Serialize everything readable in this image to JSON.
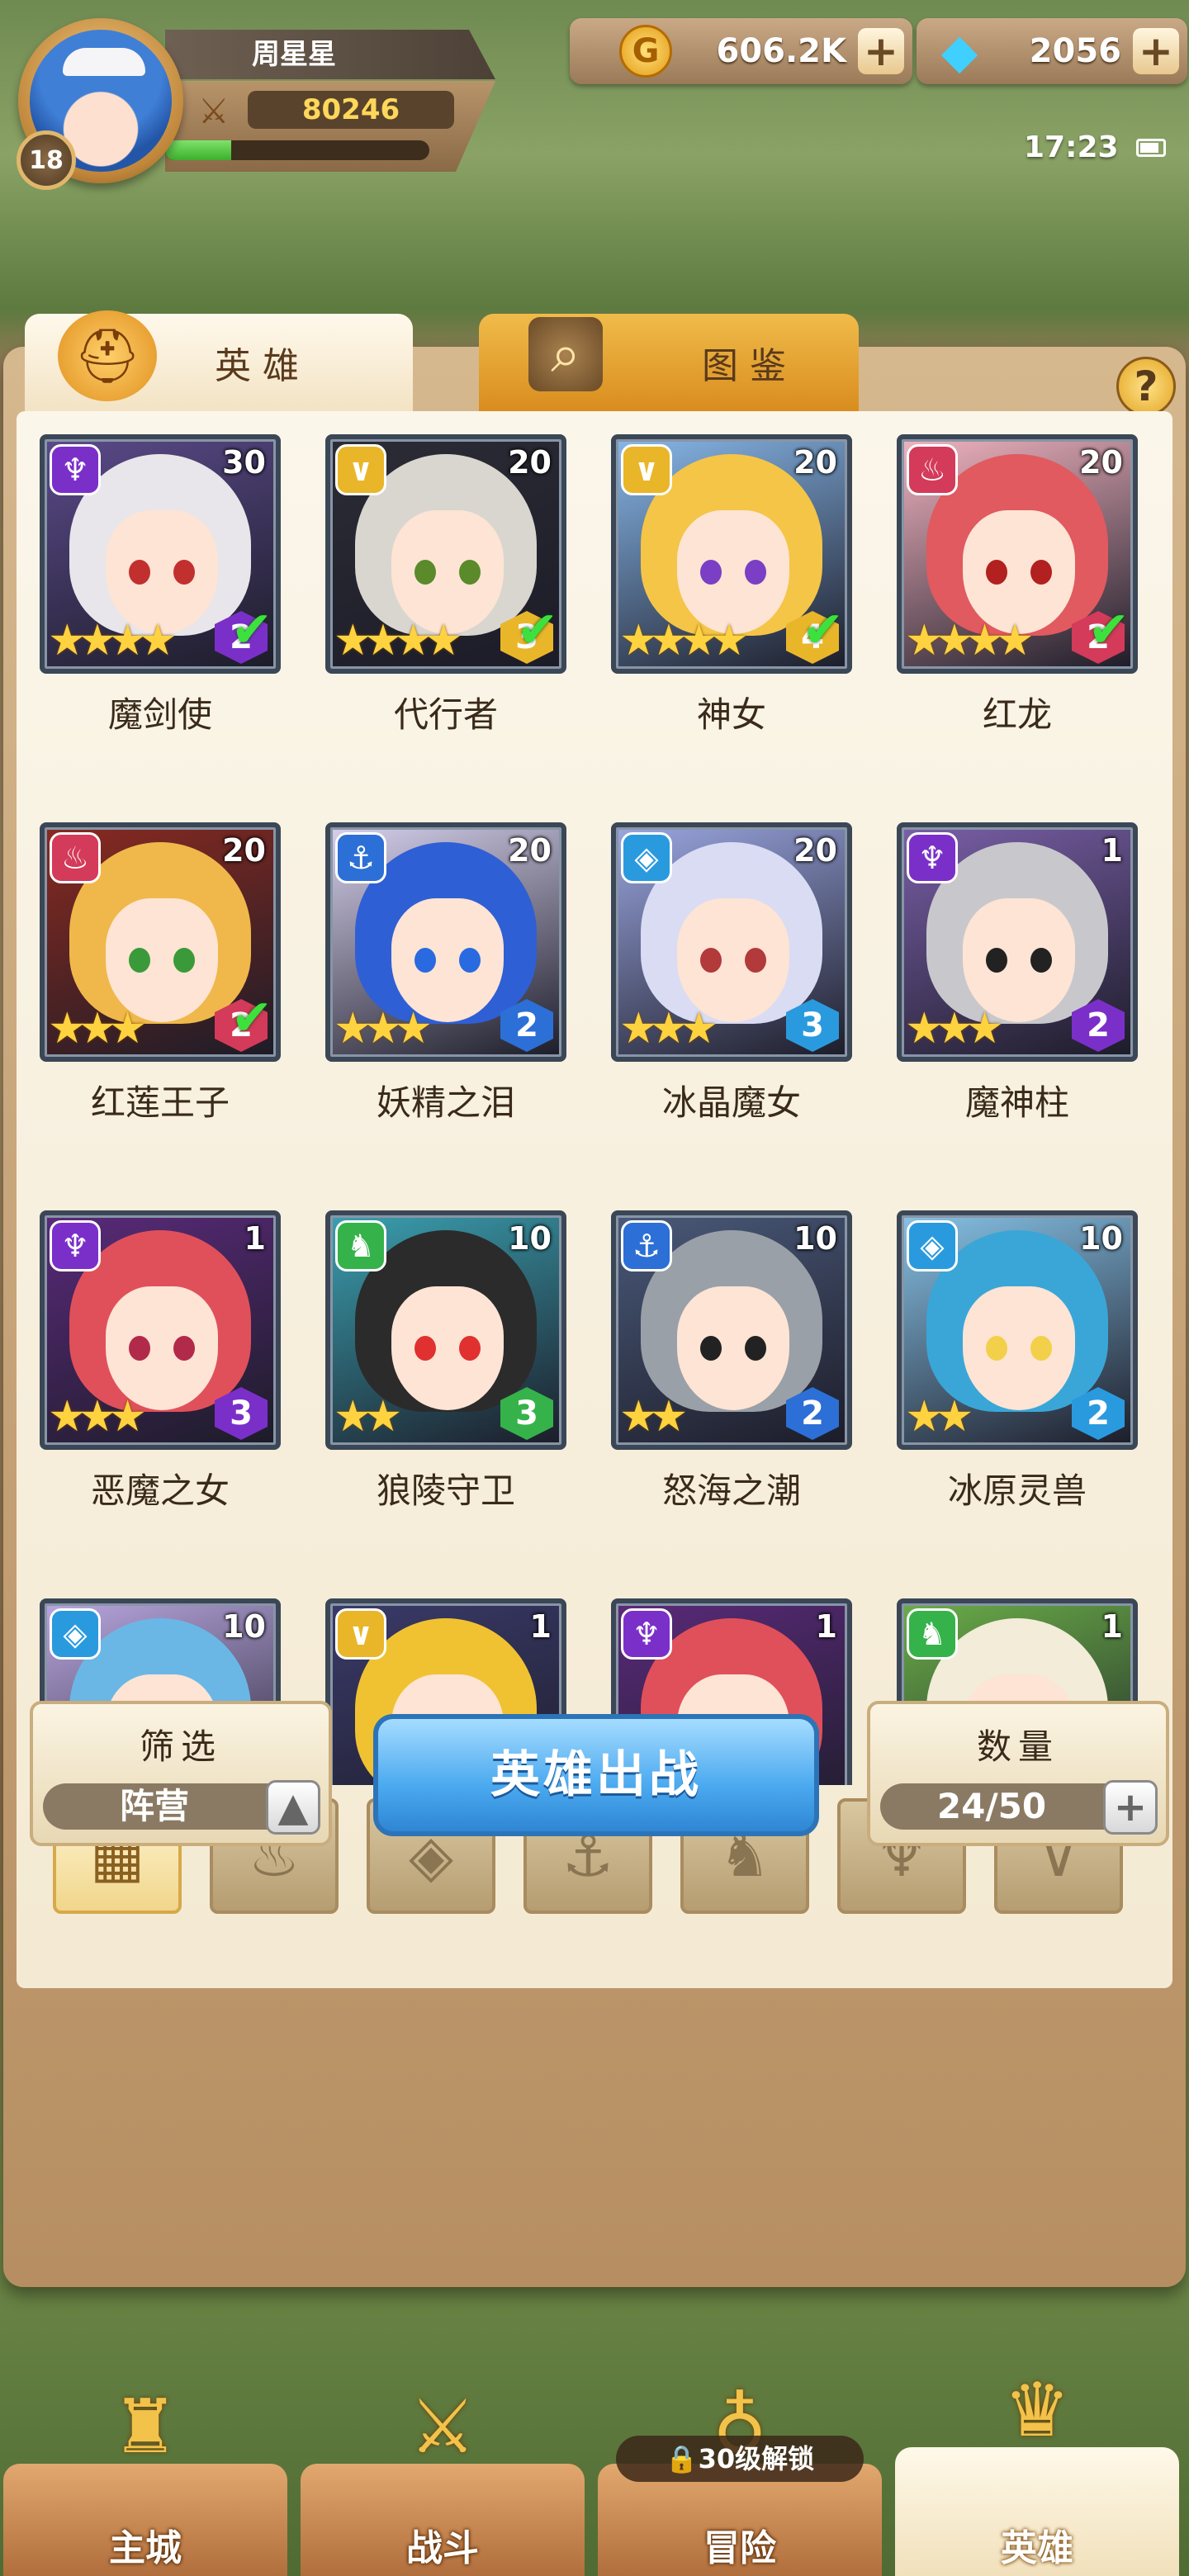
{
  "player": {
    "name": "周星星",
    "level": "18",
    "power": "80246",
    "exp_fraction": 0.25
  },
  "resources": {
    "gold": "606.2K",
    "gems": "2056",
    "gold_icon": "coin-icon",
    "gem_icon": "diamond-icon"
  },
  "status": {
    "time": "17:23"
  },
  "tabs": [
    {
      "label": "英雄",
      "icon": "helmet-icon",
      "active": true
    },
    {
      "label": "图鉴",
      "icon": "magnifier-icon",
      "active": false
    }
  ],
  "help_label": "?",
  "faction_colors": {
    "demon": "#7b2fc9",
    "light": "#e9b62a",
    "fire": "#d43a5a",
    "sea": "#2c6fd6",
    "ice": "#2a9adf",
    "beast": "#36b24a"
  },
  "heroes": [
    {
      "name": "魔剑使",
      "level": "30",
      "stars": 4,
      "rank": "2",
      "faction": "demon",
      "check": true,
      "hair": "#e8e6ea",
      "eye": "#c22f2f",
      "bg": "#5b4a8a"
    },
    {
      "name": "代行者",
      "level": "20",
      "stars": 4,
      "rank": "3",
      "faction": "light",
      "check": true,
      "hair": "#d9d6d0",
      "eye": "#5a8a2a",
      "bg": "#2c2c36"
    },
    {
      "name": "神女",
      "level": "20",
      "stars": 4,
      "rank": "4",
      "faction": "light",
      "check": true,
      "hair": "#f4c547",
      "eye": "#7a3fc4",
      "bg": "#87b7e9"
    },
    {
      "name": "红龙",
      "level": "20",
      "stars": 4,
      "rank": "2",
      "faction": "fire",
      "check": true,
      "hair": "#e05a5f",
      "eye": "#b22020",
      "bg": "#f1b4c0"
    },
    {
      "name": "红莲王子",
      "level": "20",
      "stars": 3,
      "rank": "2",
      "faction": "fire",
      "check": true,
      "hair": "#f0b84a",
      "eye": "#3a9a3a",
      "bg": "#8a2a20"
    },
    {
      "name": "妖精之泪",
      "level": "20",
      "stars": 3,
      "rank": "2",
      "faction": "sea",
      "check": false,
      "hair": "#2f5fd4",
      "eye": "#2a6ae0",
      "bg": "#d6d0ec"
    },
    {
      "name": "冰晶魔女",
      "level": "20",
      "stars": 3,
      "rank": "3",
      "faction": "ice",
      "check": false,
      "hair": "#d9dcf3",
      "eye": "#b23a3a",
      "bg": "#9aa6e0"
    },
    {
      "name": "魔神柱",
      "level": "1",
      "stars": 3,
      "rank": "2",
      "faction": "demon",
      "check": false,
      "hair": "#c8c8cc",
      "eye": "#222222",
      "bg": "#7a5fa8"
    },
    {
      "name": "恶魔之女",
      "level": "1",
      "stars": 3,
      "rank": "3",
      "faction": "demon",
      "check": false,
      "hair": "#e0505a",
      "eye": "#b22a4a",
      "bg": "#5a2a7a"
    },
    {
      "name": "狼陵守卫",
      "level": "10",
      "stars": 2,
      "rank": "3",
      "faction": "beast",
      "check": false,
      "hair": "#2b2b2b",
      "eye": "#e03030",
      "bg": "#3aa0b0"
    },
    {
      "name": "怒海之潮",
      "level": "10",
      "stars": 2,
      "rank": "2",
      "faction": "sea",
      "check": false,
      "hair": "#9aa0a8",
      "eye": "#222222",
      "bg": "#4a5a7a"
    },
    {
      "name": "冰原灵兽",
      "level": "10",
      "stars": 2,
      "rank": "2",
      "faction": "ice",
      "check": false,
      "hair": "#3aa6d8",
      "eye": "#f2d04a",
      "bg": "#87c2e6"
    },
    {
      "name": "",
      "level": "10",
      "stars": 0,
      "rank": "",
      "faction": "ice",
      "check": false,
      "hair": "#6ab7e6",
      "eye": "#2a8ad0",
      "bg": "#b9a6df"
    },
    {
      "name": "",
      "level": "1",
      "stars": 0,
      "rank": "",
      "faction": "light",
      "check": false,
      "hair": "#f0c232",
      "eye": "#2a7ac0",
      "bg": "#3a3a6a"
    },
    {
      "name": "",
      "level": "1",
      "stars": 0,
      "rank": "",
      "faction": "demon",
      "check": false,
      "hair": "#e0505a",
      "eye": "#b22a4a",
      "bg": "#5a2a7a"
    },
    {
      "name": "",
      "level": "1",
      "stars": 0,
      "rank": "",
      "faction": "beast",
      "check": false,
      "hair": "#f2ecd8",
      "eye": "#2aa0a0",
      "bg": "#6aae48"
    }
  ],
  "filters": [
    {
      "icon": "grid-icon",
      "glyph": "▦",
      "active": true
    },
    {
      "icon": "flame-icon",
      "glyph": "♨",
      "active": false
    },
    {
      "icon": "ice-crystal-icon",
      "glyph": "◈",
      "active": false
    },
    {
      "icon": "anchor-icon",
      "glyph": "⚓",
      "active": false
    },
    {
      "icon": "wolf-head-icon",
      "glyph": "♞",
      "active": false
    },
    {
      "icon": "demon-horn-icon",
      "glyph": "♆",
      "active": false
    },
    {
      "icon": "light-wing-icon",
      "glyph": "∨",
      "active": false
    }
  ],
  "controls": {
    "filter_title": "筛选",
    "filter_value": "阵营",
    "battle_label": "英雄出战",
    "count_title": "数量",
    "count_value": "24/50"
  },
  "nav": [
    {
      "label": "主城",
      "icon": "castle-icon",
      "active": false,
      "lock": ""
    },
    {
      "label": "战斗",
      "icon": "crossed-swords-icon",
      "active": false,
      "lock": ""
    },
    {
      "label": "冒险",
      "icon": "treasure-sack-icon",
      "active": false,
      "lock": "30级解锁"
    },
    {
      "label": "英雄",
      "icon": "hero-crest-icon",
      "active": true,
      "lock": ""
    }
  ]
}
